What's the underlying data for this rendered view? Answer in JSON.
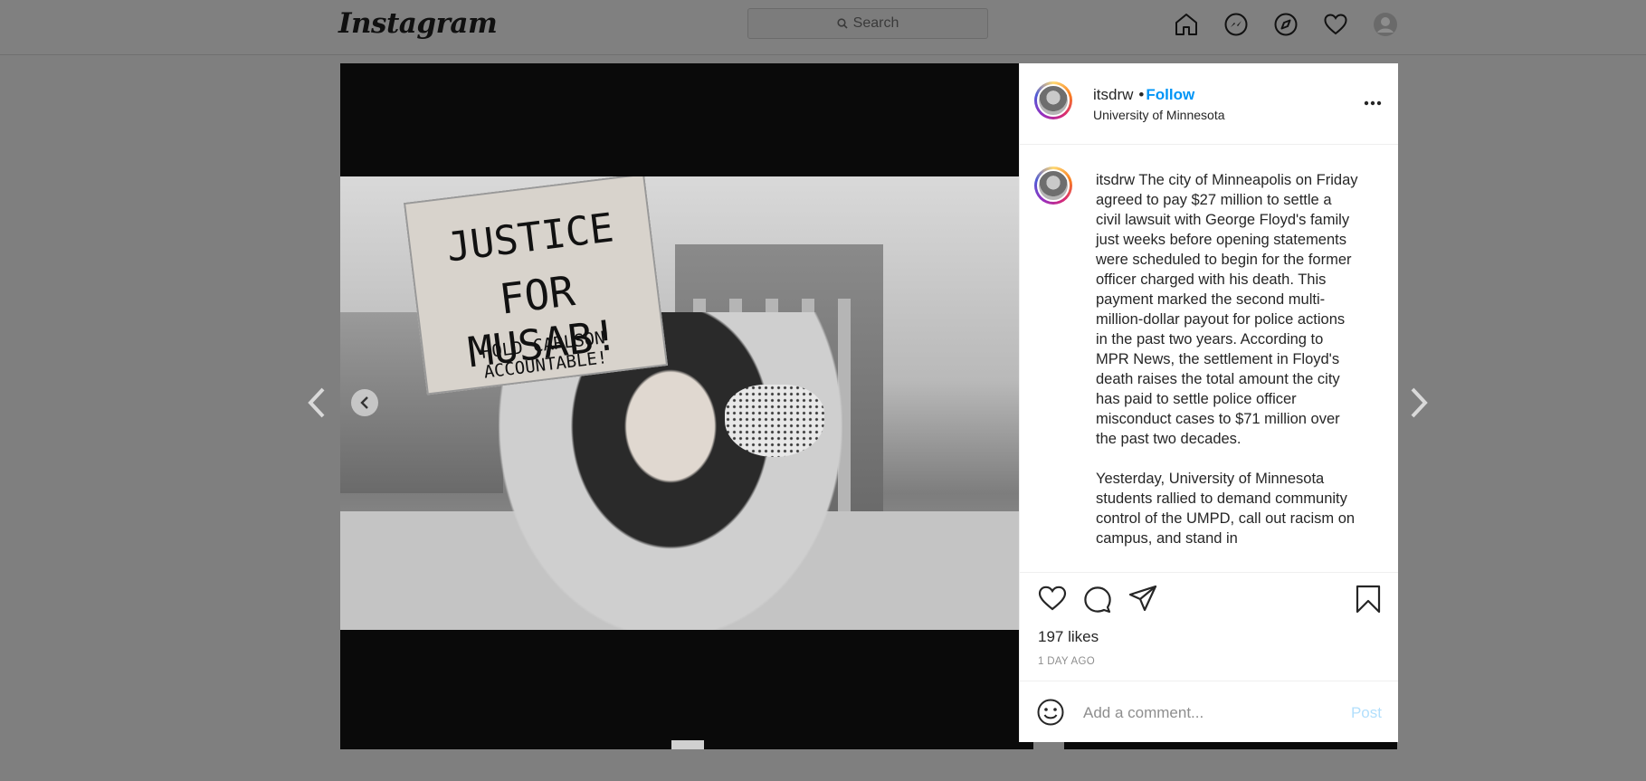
{
  "nav": {
    "logo": "Instagram",
    "search_placeholder": "Search",
    "icons": [
      "home-icon",
      "messenger-icon",
      "explore-icon",
      "heart-icon",
      "profile-avatar"
    ]
  },
  "media": {
    "sign_line1": "JUSTICE",
    "sign_line2": "FOR MUSAB!",
    "sign_line3": "HOLD CARLSON ACCOUNTABLE!",
    "carousel_total": 4,
    "carousel_active_index": 4
  },
  "post": {
    "username": "itsdrw",
    "separator": "•",
    "follow_label": "Follow",
    "location": "University of Minnesota",
    "caption_user": "itsdrw",
    "caption_text": "The city of Minneapolis on Friday agreed to pay $27 million to settle a civil lawsuit with George Floyd's family just weeks before opening statements were scheduled to begin for the former officer charged with his death. This payment marked the second multi-million-dollar payout for police actions in the past two years. According to MPR News, the settlement in Floyd's death raises the total amount the city has paid to settle police officer misconduct cases to $71 million over the past two decades.\n\nYesterday, University of Minnesota students rallied to demand community control of the UMPD, call out racism on campus, and stand in",
    "likes": "197 likes",
    "time_ago": "1 DAY AGO",
    "comment_placeholder": "Add a comment...",
    "post_label": "Post"
  },
  "colors": {
    "follow": "#0095f6",
    "post_disabled": "#b2dffc",
    "overlay_bg": "#7f7f7f"
  }
}
